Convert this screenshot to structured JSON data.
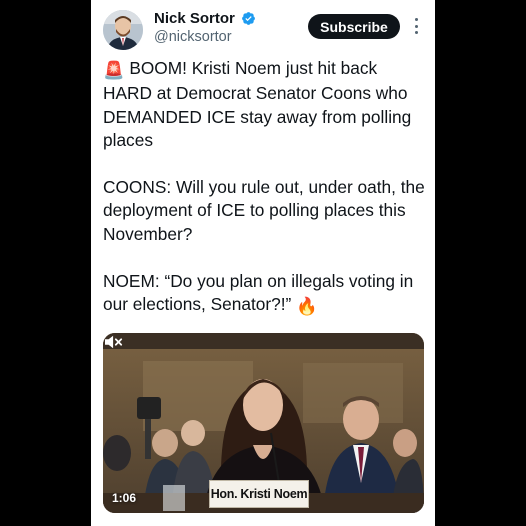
{
  "author": {
    "name": "Nick Sortor",
    "handle": "@nicksortor",
    "verified": true
  },
  "actions": {
    "subscribe_label": "Subscribe",
    "more_icon": "more-vertical-icon"
  },
  "tweet": {
    "paragraphs": [
      {
        "emoji": "🚨",
        "text": "BOOM! Kristi Noem just hit back HARD at Democrat Senator Coons who DEMANDED ICE stay away from polling places"
      },
      {
        "text": "COONS: Will you rule out, under oath, the deployment of ICE to polling places this November?"
      },
      {
        "text": "NOEM: “Do you plan on illegals voting in our elections, Senator?!”",
        "emoji_after": "🔥"
      }
    ]
  },
  "media": {
    "type": "video",
    "duration": "1:06",
    "caption": "Hon. Kristi Noem",
    "mute_icon": "volume-muted-icon"
  },
  "colors": {
    "text": "#0f1419",
    "secondary": "#536471",
    "verified": "#1d9bf0",
    "button_bg": "#0f1419"
  }
}
